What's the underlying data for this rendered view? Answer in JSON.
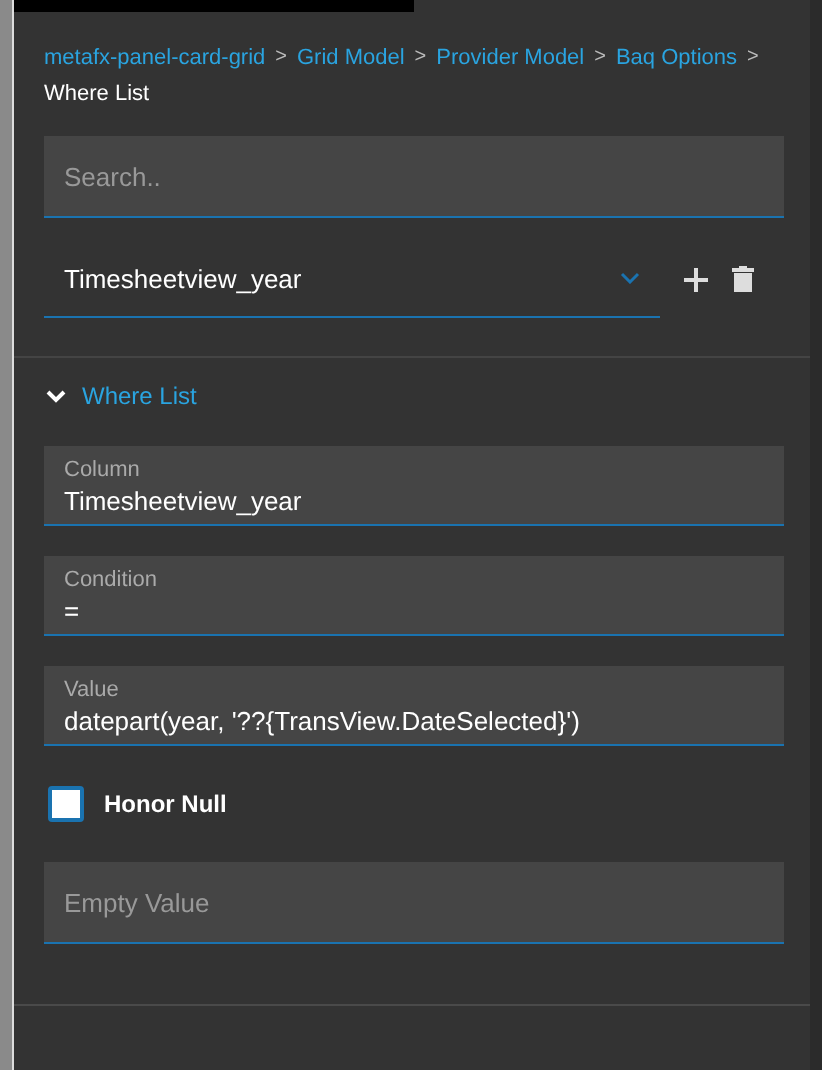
{
  "breadcrumbs": [
    {
      "label": "metafx-panel-card-grid",
      "current": false
    },
    {
      "separator": ">",
      "label": "Grid Model",
      "current": false
    },
    {
      "separator": ">",
      "label": "Provider Model",
      "current": false
    },
    {
      "separator": ">",
      "label": "Baq Options",
      "current": false
    },
    {
      "separator": ">",
      "label": "Where List",
      "current": true
    }
  ],
  "search": {
    "placeholder": "Search.."
  },
  "selector": {
    "value": "Timesheetview_year"
  },
  "section": {
    "title": "Where List",
    "expanded": true
  },
  "fields": [
    {
      "label": "Column",
      "value": "Timesheetview_year"
    },
    {
      "label": "Condition",
      "value": "="
    },
    {
      "label": "Value",
      "value": "datepart(year, '??{TransView.DateSelected}')"
    }
  ],
  "honor_null": {
    "label": "Honor Null",
    "checked": false
  },
  "empty_value": {
    "placeholder": "Empty Value"
  }
}
